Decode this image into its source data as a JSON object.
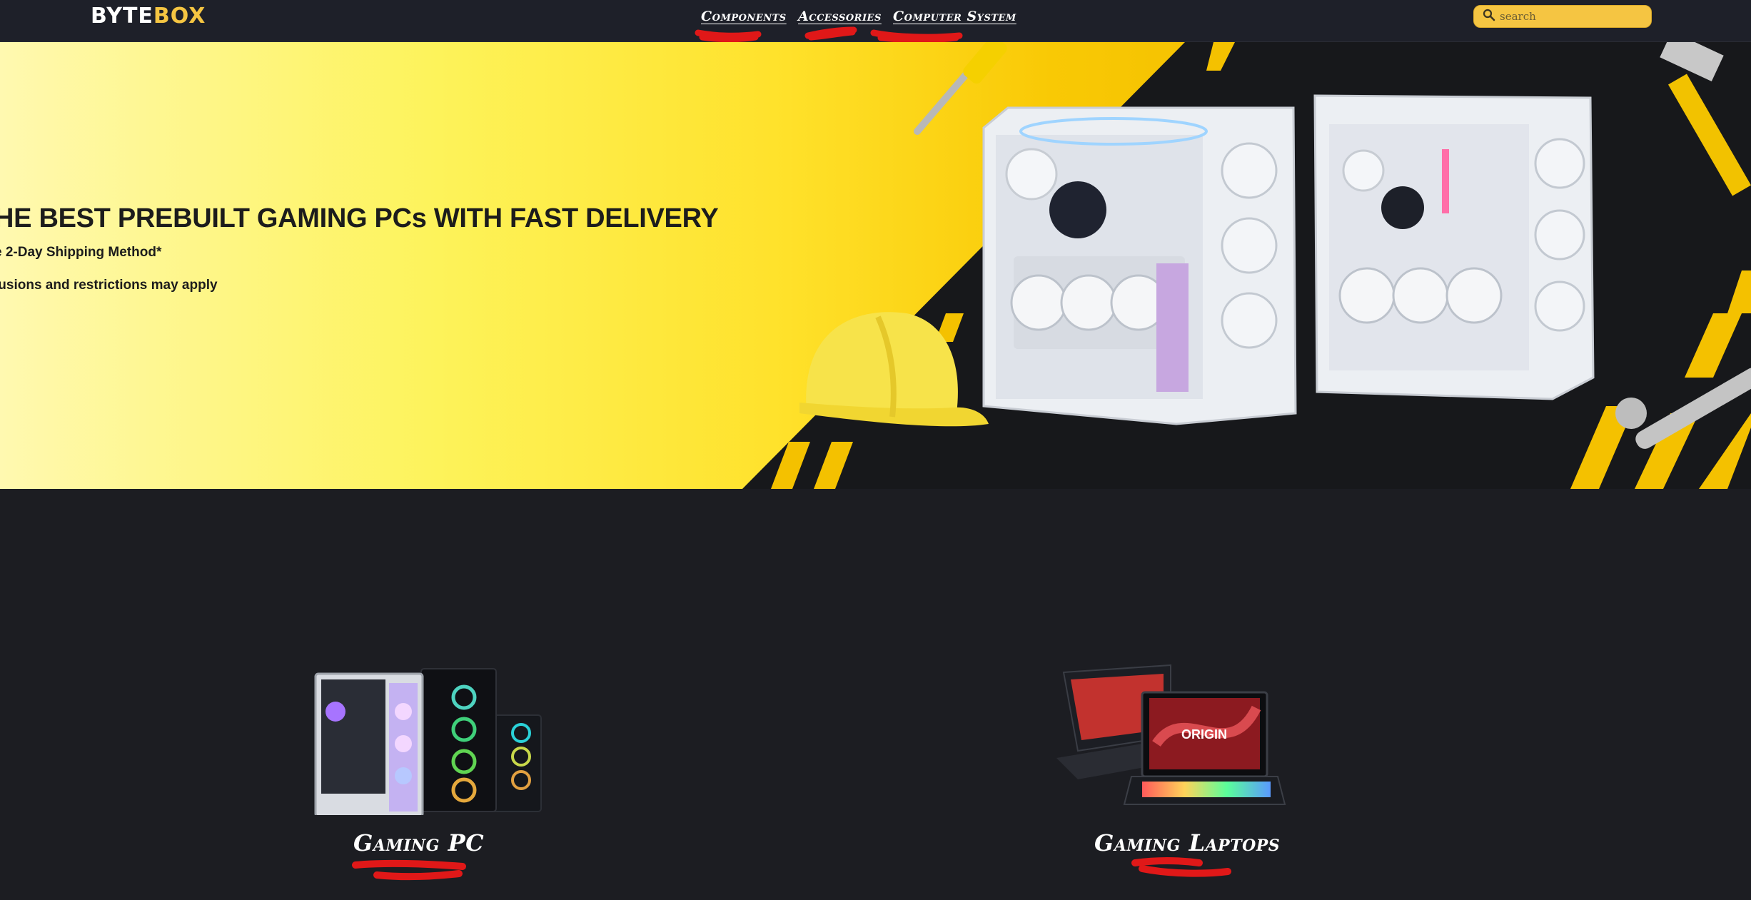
{
  "brand": {
    "part1": "BYTE",
    "part2": "BOX"
  },
  "nav": {
    "components": "Components",
    "accessories": "Accessories",
    "computer_system": "Computer System"
  },
  "search": {
    "placeholder": "search"
  },
  "hero": {
    "title": "HE BEST PREBUILT GAMING PCs WITH FAST DELIVERY",
    "subtitle": "e 2-Day Shipping Method*",
    "note": "lusions and restrictions may apply"
  },
  "categories": {
    "gaming_pc": "Gaming PC",
    "gaming_laptops": "Gaming Laptops"
  },
  "colors": {
    "accent": "#f5c542",
    "background": "#1c1d22",
    "navbar": "#1e2029",
    "annotation": "#e01818"
  },
  "icons": {
    "search": "search-icon"
  }
}
